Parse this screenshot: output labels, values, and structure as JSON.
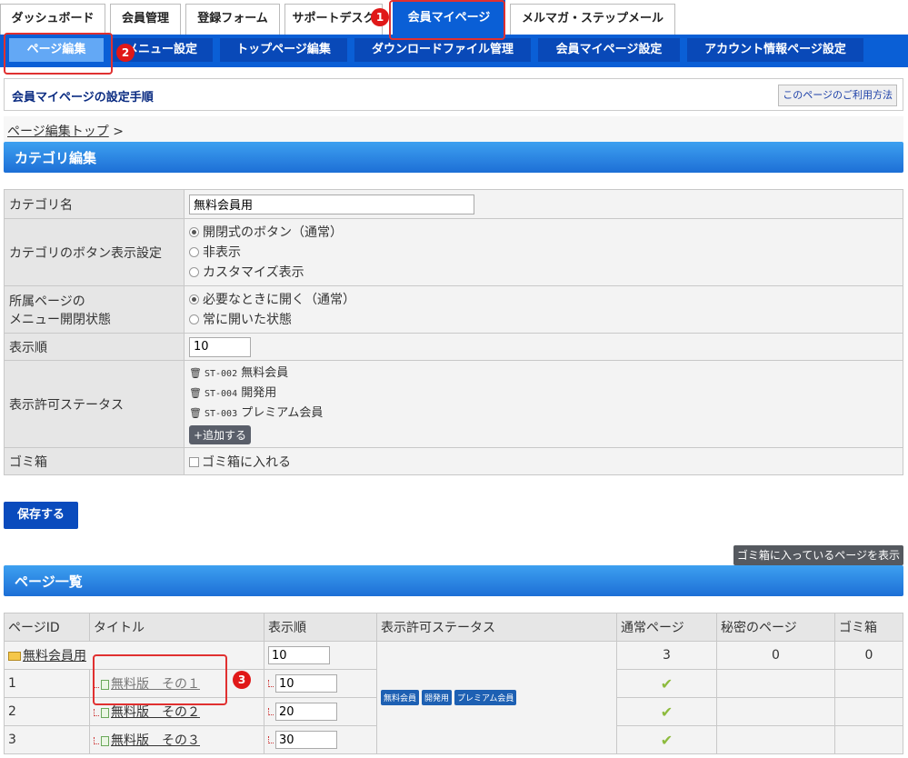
{
  "top_tabs": [
    "ダッシュボード",
    "会員管理",
    "登録フォーム",
    "サポートデスク",
    "会員マイページ",
    "メルマガ・ステップメール"
  ],
  "sub_nav": [
    "ページ編集",
    "メニュー設定",
    "トップページ編集",
    "ダウンロードファイル管理",
    "会員マイページ設定",
    "アカウント情報ページ設定"
  ],
  "callouts": [
    "1",
    "2",
    "3"
  ],
  "setup": {
    "title": "会員マイページの設定手順",
    "help": "このページのご利用方法"
  },
  "breadcrumb": {
    "link": "ページ編集トップ",
    "sep": ">"
  },
  "category_section": "カテゴリ編集",
  "form": {
    "name_label": "カテゴリ名",
    "name_value": "無料会員用",
    "button_label": "カテゴリのボタン表示設定",
    "button_options": [
      "開閉式のボタン（通常）",
      "非表示",
      "カスタマイズ表示"
    ],
    "menu_label_1": "所属ページの",
    "menu_label_2": "メニュー開閉状態",
    "menu_options": [
      "必要なときに開く（通常）",
      "常に開いた状態"
    ],
    "order_label": "表示順",
    "order_value": "10",
    "status_label": "表示許可ステータス",
    "statuses": [
      {
        "code": "ST-002",
        "name": "無料会員"
      },
      {
        "code": "ST-004",
        "name": "開発用"
      },
      {
        "code": "ST-003",
        "name": "プレミアム会員"
      }
    ],
    "add_button": "+追加する",
    "trash_label": "ゴミ箱",
    "trash_option": "ゴミ箱に入れる"
  },
  "save_button": "保存する",
  "trash_view_button": "ゴミ箱に入っているページを表示",
  "page_list_section": "ページ一覧",
  "table": {
    "headers": [
      "ページID",
      "タイトル",
      "表示順",
      "表示許可ステータス",
      "通常ページ",
      "秘密のページ",
      "ゴミ箱"
    ],
    "category": {
      "title": "無料会員用",
      "order": "10",
      "normal": "3",
      "secret": "0",
      "trash": "0"
    },
    "rows": [
      {
        "id": "1",
        "title": "無料版　その１",
        "order": "10"
      },
      {
        "id": "2",
        "title": "無料版　その２",
        "order": "20"
      },
      {
        "id": "3",
        "title": "無料版　その３",
        "order": "30"
      }
    ],
    "status_tags": [
      "無料会員",
      "開発用",
      "プレミアム会員"
    ],
    "check": "✔"
  }
}
